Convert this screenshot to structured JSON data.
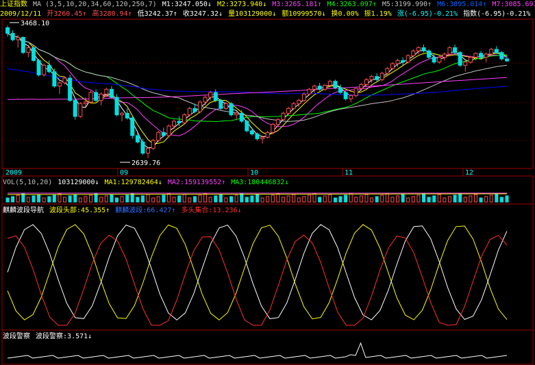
{
  "colors": {
    "bg": "#000000",
    "border": "#a00000",
    "grid": "#5a0000",
    "up": "#ff5050",
    "down": "#00e0e0",
    "yellow": "#ffff00",
    "white": "#ffffff",
    "magenta": "#ff40ff",
    "green": "#00ff00",
    "blue": "#0000ff",
    "cyan": "#00ffff",
    "red": "#ff3030"
  },
  "header1": {
    "title": "上证指数",
    "ma_label": "MA (3,5,10,20,34,60,120,250,7)",
    "m1": "M1:3247.050↓",
    "m2": "M2:3273.940↓",
    "m3": "M3:3265.181↑",
    "m4": "M4:3263.097↑",
    "m5": "M5:3199.990↑",
    "m6": "M6:3095.014↑",
    "m7": "M7:3085.691↑"
  },
  "header2": {
    "date": "2009/12/11",
    "open": "开3260.45↑",
    "high": "高3280.94↑",
    "low": "低3242.37↑",
    "close": "收3247.32↓",
    "volume": "量103129000↓",
    "amount": "额10999570↓",
    "turnover": "换0.00%",
    "amplitude": "振1.19%",
    "change": "涨(-6.95)-0.21%",
    "index": "指数(-6.95)-0.21%"
  },
  "price_annotations": {
    "high_label": "3468.10",
    "low_label": "2639.76"
  },
  "x_axis": {
    "labels": [
      "2009",
      "09",
      "10",
      "11",
      "12"
    ]
  },
  "vol_header": {
    "label": "VOL(5,10,20)",
    "value": "103129000↓",
    "ma1": "MA1:129782464↓",
    "ma2": "MA2:159139552↑",
    "ma3": "MA3:180446832↓"
  },
  "nav_header": {
    "name": "麒麟波段导航",
    "peak": "波段头部:45.355↑",
    "band": "麒麟波段:66.427↑",
    "bull": "多头集合:13.236↓"
  },
  "police_header": {
    "name": "波段警察",
    "value": "波段警察:3.571↓"
  },
  "chart_data": {
    "type": "candlestick",
    "title": "上证指数",
    "ylim": [
      2600,
      3500
    ],
    "candles": [
      [
        3455,
        3468,
        3400,
        3420
      ],
      [
        3420,
        3440,
        3370,
        3380
      ],
      [
        3380,
        3410,
        3330,
        3395
      ],
      [
        3395,
        3400,
        3290,
        3300
      ],
      [
        3300,
        3340,
        3270,
        3330
      ],
      [
        3330,
        3345,
        3240,
        3250
      ],
      [
        3250,
        3260,
        3150,
        3160
      ],
      [
        3160,
        3230,
        3150,
        3220
      ],
      [
        3220,
        3250,
        3170,
        3180
      ],
      [
        3180,
        3200,
        3080,
        3090
      ],
      [
        3090,
        3120,
        3040,
        3110
      ],
      [
        3110,
        3150,
        3100,
        3140
      ],
      [
        3140,
        3160,
        2990,
        3000
      ],
      [
        3000,
        3020,
        2880,
        2900
      ],
      [
        2900,
        2990,
        2890,
        2980
      ],
      [
        2980,
        3020,
        2960,
        2990
      ],
      [
        2990,
        3060,
        2980,
        3050
      ],
      [
        3050,
        3070,
        2990,
        3000
      ],
      [
        3000,
        3050,
        2970,
        3040
      ],
      [
        3040,
        3080,
        3020,
        3070
      ],
      [
        3070,
        3090,
        3010,
        3020
      ],
      [
        3020,
        3040,
        2900,
        2910
      ],
      [
        2910,
        2930,
        2870,
        2920
      ],
      [
        2920,
        2950,
        2880,
        2890
      ],
      [
        2890,
        2900,
        2760,
        2780
      ],
      [
        2780,
        2800,
        2730,
        2740
      ],
      [
        2740,
        2760,
        2660,
        2670
      ],
      [
        2670,
        2710,
        2640,
        2700
      ],
      [
        2700,
        2760,
        2690,
        2750
      ],
      [
        2750,
        2810,
        2740,
        2800
      ],
      [
        2800,
        2830,
        2770,
        2780
      ],
      [
        2780,
        2850,
        2770,
        2840
      ],
      [
        2840,
        2880,
        2820,
        2870
      ],
      [
        2870,
        2900,
        2840,
        2860
      ],
      [
        2860,
        2920,
        2850,
        2910
      ],
      [
        2910,
        2960,
        2900,
        2950
      ],
      [
        2950,
        2980,
        2920,
        2930
      ],
      [
        2930,
        3000,
        2920,
        2990
      ],
      [
        2990,
        3030,
        2970,
        3020
      ],
      [
        3020,
        3060,
        3000,
        3050
      ],
      [
        3050,
        3070,
        2990,
        3000
      ],
      [
        3000,
        3010,
        2940,
        2950
      ],
      [
        2950,
        2990,
        2940,
        2980
      ],
      [
        2980,
        2990,
        2900,
        2910
      ],
      [
        2910,
        2930,
        2880,
        2920
      ],
      [
        2920,
        2940,
        2860,
        2870
      ],
      [
        2870,
        2880,
        2800,
        2810
      ],
      [
        2810,
        2830,
        2780,
        2790
      ],
      [
        2790,
        2800,
        2750,
        2760
      ],
      [
        2760,
        2780,
        2730,
        2770
      ],
      [
        2770,
        2810,
        2760,
        2800
      ],
      [
        2800,
        2860,
        2790,
        2850
      ],
      [
        2850,
        2890,
        2840,
        2880
      ],
      [
        2880,
        2930,
        2870,
        2920
      ],
      [
        2920,
        2960,
        2910,
        2950
      ],
      [
        2950,
        2990,
        2940,
        2980
      ],
      [
        2980,
        3010,
        2960,
        3000
      ],
      [
        3000,
        3050,
        2990,
        3040
      ],
      [
        3040,
        3080,
        3030,
        3070
      ],
      [
        3070,
        3100,
        3050,
        3090
      ],
      [
        3090,
        3110,
        3060,
        3070
      ],
      [
        3070,
        3100,
        3060,
        3095
      ],
      [
        3095,
        3130,
        3080,
        3120
      ],
      [
        3120,
        3130,
        3070,
        3080
      ],
      [
        3080,
        3100,
        3040,
        3050
      ],
      [
        3050,
        3060,
        3000,
        3010
      ],
      [
        3010,
        3040,
        2990,
        3030
      ],
      [
        3030,
        3080,
        3020,
        3075
      ],
      [
        3075,
        3110,
        3060,
        3100
      ],
      [
        3100,
        3140,
        3090,
        3130
      ],
      [
        3130,
        3160,
        3110,
        3150
      ],
      [
        3150,
        3170,
        3120,
        3130
      ],
      [
        3130,
        3180,
        3120,
        3170
      ],
      [
        3170,
        3210,
        3160,
        3200
      ],
      [
        3200,
        3240,
        3190,
        3230
      ],
      [
        3230,
        3260,
        3210,
        3250
      ],
      [
        3250,
        3270,
        3220,
        3240
      ],
      [
        3240,
        3290,
        3230,
        3280
      ],
      [
        3280,
        3320,
        3270,
        3310
      ],
      [
        3310,
        3340,
        3290,
        3330
      ],
      [
        3330,
        3350,
        3300,
        3310
      ],
      [
        3310,
        3320,
        3260,
        3270
      ],
      [
        3270,
        3290,
        3230,
        3240
      ],
      [
        3240,
        3280,
        3230,
        3270
      ],
      [
        3270,
        3300,
        3250,
        3290
      ],
      [
        3290,
        3340,
        3280,
        3330
      ],
      [
        3330,
        3350,
        3290,
        3300
      ],
      [
        3300,
        3310,
        3210,
        3220
      ],
      [
        3220,
        3250,
        3180,
        3240
      ],
      [
        3240,
        3280,
        3230,
        3270
      ],
      [
        3270,
        3300,
        3250,
        3295
      ],
      [
        3295,
        3310,
        3260,
        3270
      ],
      [
        3270,
        3300,
        3240,
        3290
      ],
      [
        3290,
        3330,
        3280,
        3320
      ],
      [
        3320,
        3340,
        3290,
        3300
      ],
      [
        3300,
        3310,
        3250,
        3260
      ],
      [
        3260,
        3281,
        3242,
        3247
      ]
    ]
  }
}
